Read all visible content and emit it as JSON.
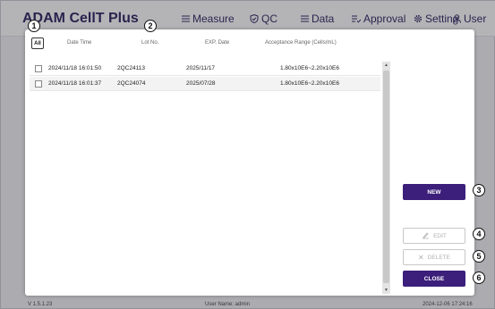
{
  "app": {
    "title": "ADAM CellT Plus",
    "nav": [
      {
        "label": "Measure",
        "icon": "list-icon"
      },
      {
        "label": "QC",
        "icon": "shield-check-icon"
      },
      {
        "label": "Data",
        "icon": "list-icon"
      },
      {
        "label": "Approval",
        "icon": "list-approval-icon"
      },
      {
        "label": "Setting",
        "icon": "gear-icon"
      },
      {
        "label": "User",
        "icon": "user-icon"
      }
    ],
    "status": {
      "version": "V 1.5.1.23",
      "user": "User Name: admin",
      "datetime": "2024-12-06 17:24:16"
    }
  },
  "dialog": {
    "all_label": "All",
    "columns": {
      "date_time": "Date Time",
      "lot_no": "Lot No.",
      "exp_date": "EXP. Date",
      "range": "Acceptance Range (Cells/mL)"
    },
    "rows": [
      {
        "date_time": "2024/11/18 16:01:50",
        "lot_no": "2QC24113",
        "exp_date": "2025/11/17",
        "range": "1.80x10E6~2.20x10E6"
      },
      {
        "date_time": "2024/11/18 16:01:37",
        "lot_no": "2QC24074",
        "exp_date": "2025/07/28",
        "range": "1.80x10E6~2.20x10E6"
      }
    ],
    "buttons": {
      "new": "NEW",
      "edit": "EDIT",
      "delete": "DELETE",
      "close": "CLOSE"
    }
  },
  "callouts": [
    "1",
    "2",
    "3",
    "4",
    "5",
    "6"
  ],
  "colors": {
    "primary": "#3b1f7a",
    "brand_text": "#2b1f5c"
  }
}
